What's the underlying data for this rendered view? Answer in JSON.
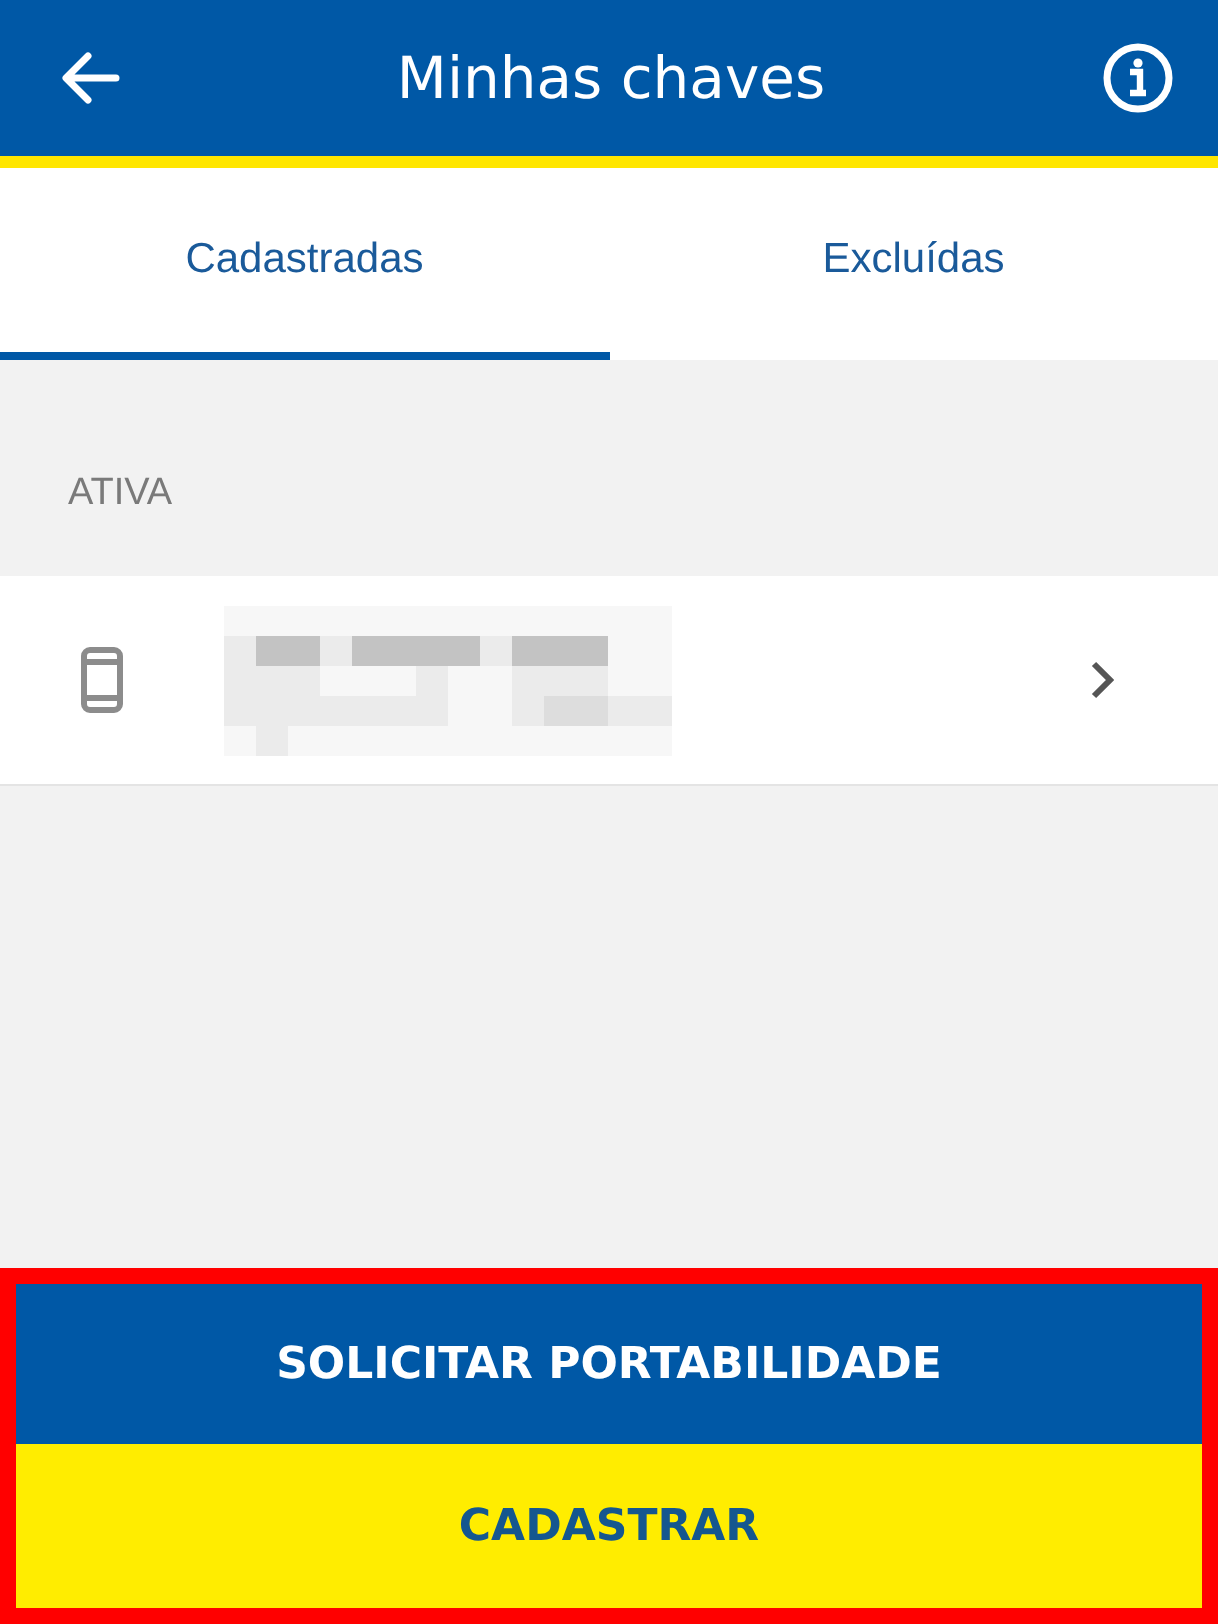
{
  "header": {
    "title": "Minhas chaves"
  },
  "tabs": [
    {
      "label": "Cadastradas",
      "selected": true
    },
    {
      "label": "Excluídas",
      "selected": false
    }
  ],
  "section": {
    "heading": "ATIVA",
    "keys": [
      {
        "kind": "phone"
      }
    ]
  },
  "actions": [
    {
      "label": "SOLICITAR PORTABILIDADE",
      "kind": "primary"
    },
    {
      "label": "CADASTRAR",
      "kind": "secondary"
    }
  ],
  "highlighted": true
}
